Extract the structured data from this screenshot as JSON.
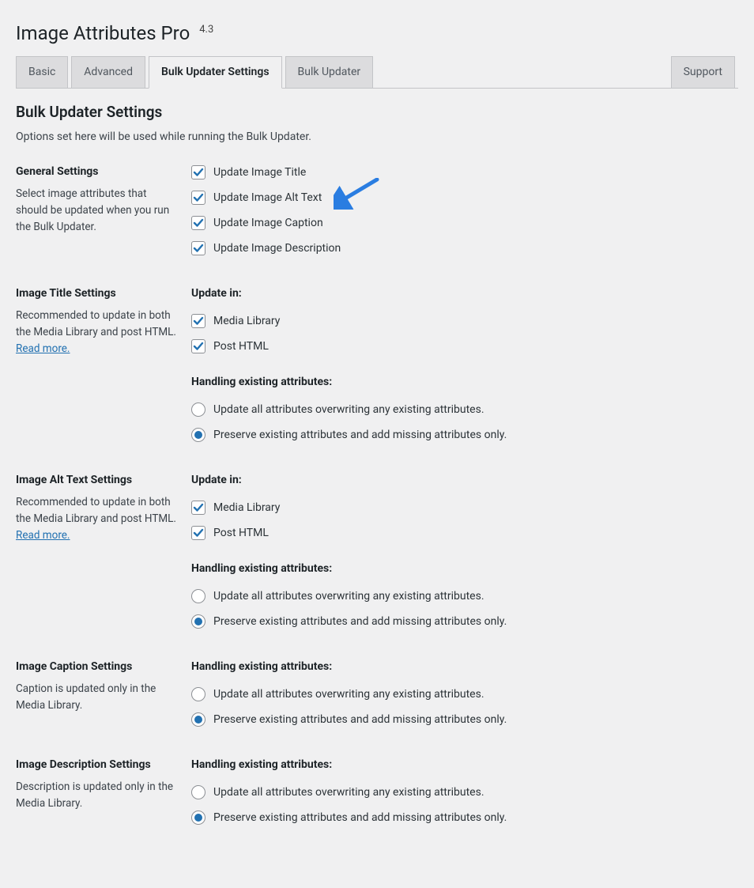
{
  "header": {
    "title": "Image Attributes Pro",
    "version": "4.3"
  },
  "tabs": {
    "items": [
      {
        "label": "Basic"
      },
      {
        "label": "Advanced"
      },
      {
        "label": "Bulk Updater Settings"
      },
      {
        "label": "Bulk Updater"
      },
      {
        "label": "Support"
      }
    ],
    "active_index": 2
  },
  "page": {
    "heading": "Bulk Updater Settings",
    "description": "Options set here will be used while running the Bulk Updater."
  },
  "sections": {
    "general": {
      "title": "General Settings",
      "desc": "Select image attributes that should be updated when you run the Bulk Updater.",
      "options": [
        {
          "label": "Update Image Title",
          "checked": true
        },
        {
          "label": "Update Image Alt Text",
          "checked": true
        },
        {
          "label": "Update Image Caption",
          "checked": true
        },
        {
          "label": "Update Image Description",
          "checked": true
        }
      ]
    },
    "title": {
      "title": "Image Title Settings",
      "desc": "Recommended to update in both the Media Library and post HTML. ",
      "read_more": "Read more.",
      "update_in_label": "Update in:",
      "update_in": [
        {
          "label": "Media Library",
          "checked": true
        },
        {
          "label": "Post HTML",
          "checked": true
        }
      ],
      "handling_label": "Handling existing attributes:",
      "handling": [
        {
          "label": "Update all attributes overwriting any existing attributes.",
          "checked": false
        },
        {
          "label": "Preserve existing attributes and add missing attributes only.",
          "checked": true
        }
      ]
    },
    "alt": {
      "title": "Image Alt Text Settings",
      "desc": "Recommended to update in both the Media Library and post HTML. ",
      "read_more": "Read more.",
      "update_in_label": "Update in:",
      "update_in": [
        {
          "label": "Media Library",
          "checked": true
        },
        {
          "label": "Post HTML",
          "checked": true
        }
      ],
      "handling_label": "Handling existing attributes:",
      "handling": [
        {
          "label": "Update all attributes overwriting any existing attributes.",
          "checked": false
        },
        {
          "label": "Preserve existing attributes and add missing attributes only.",
          "checked": true
        }
      ]
    },
    "caption": {
      "title": "Image Caption Settings",
      "desc": "Caption is updated only in the Media Library.",
      "handling_label": "Handling existing attributes:",
      "handling": [
        {
          "label": "Update all attributes overwriting any existing attributes.",
          "checked": false
        },
        {
          "label": "Preserve existing attributes and add missing attributes only.",
          "checked": true
        }
      ]
    },
    "description": {
      "title": "Image Description Settings",
      "desc": "Description is updated only in the Media Library.",
      "handling_label": "Handling existing attributes:",
      "handling": [
        {
          "label": "Update all attributes overwriting any existing attributes.",
          "checked": false
        },
        {
          "label": "Preserve existing attributes and add missing attributes only.",
          "checked": true
        }
      ]
    }
  },
  "arrow_color": "#2a7de1"
}
